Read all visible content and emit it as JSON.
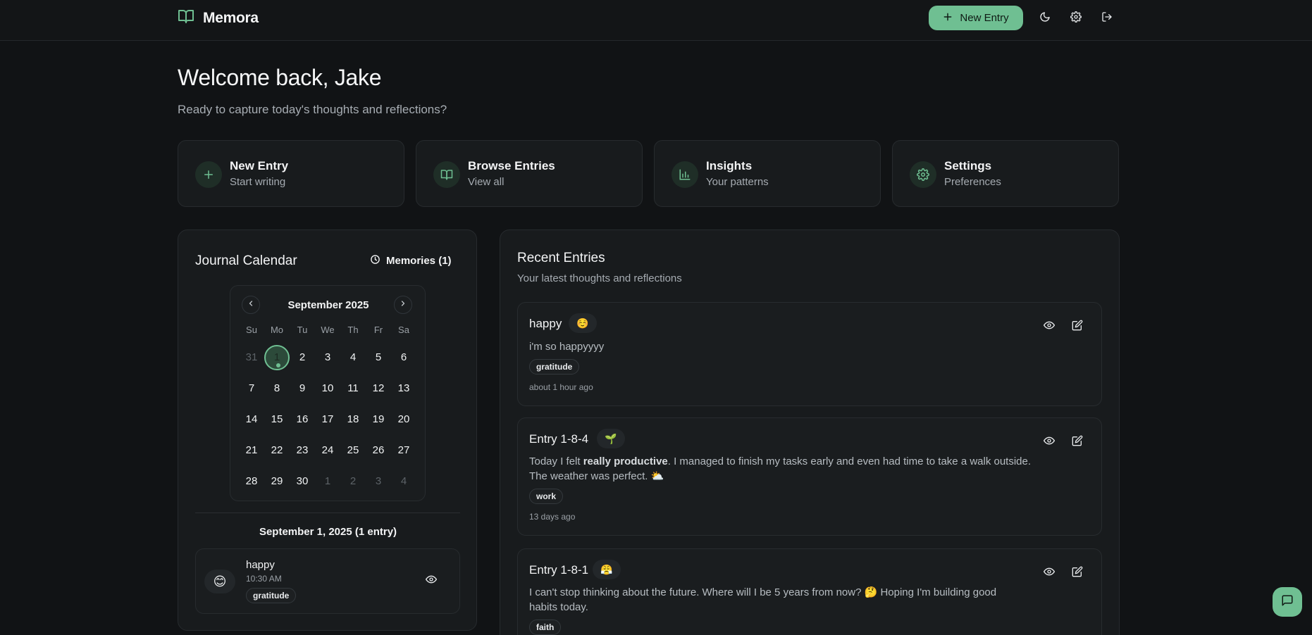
{
  "app": {
    "name": "Memora"
  },
  "header": {
    "new_entry_label": "New Entry"
  },
  "welcome": {
    "title": "Welcome back, Jake",
    "subtitle": "Ready to capture today's thoughts and reflections?"
  },
  "quick_actions": [
    {
      "title": "New Entry",
      "sub": "Start writing",
      "icon": "plus-icon"
    },
    {
      "title": "Browse Entries",
      "sub": "View all",
      "icon": "book-icon"
    },
    {
      "title": "Insights",
      "sub": "Your patterns",
      "icon": "chart-icon"
    },
    {
      "title": "Settings",
      "sub": "Preferences",
      "icon": "gear-icon"
    }
  ],
  "calendar": {
    "title": "Journal Calendar",
    "memories_label": "Memories (1)",
    "month": "September 2025",
    "weekdays": [
      "Su",
      "Mo",
      "Tu",
      "We",
      "Th",
      "Fr",
      "Sa"
    ],
    "days": [
      [
        "31",
        "1",
        "2",
        "3",
        "4",
        "5",
        "6"
      ],
      [
        "7",
        "8",
        "9",
        "10",
        "11",
        "12",
        "13"
      ],
      [
        "14",
        "15",
        "16",
        "17",
        "18",
        "19",
        "20"
      ],
      [
        "21",
        "22",
        "23",
        "24",
        "25",
        "26",
        "27"
      ],
      [
        "28",
        "29",
        "30",
        "1",
        "2",
        "3",
        "4"
      ]
    ],
    "selected_label": "September 1, 2025 (1 entry)",
    "day_entry": {
      "emoji": "😊",
      "title": "happy",
      "time": "10:30 AM",
      "tag": "gratitude"
    }
  },
  "recent": {
    "title": "Recent Entries",
    "subtitle": "Your latest thoughts and reflections",
    "entries": [
      {
        "title": "happy",
        "emoji": "☺️",
        "body": "i'm so happyyyy",
        "tag": "gratitude",
        "time": "about 1 hour ago"
      },
      {
        "title": "Entry 1-8-4",
        "emoji": "🌱",
        "body_pre": "Today I felt ",
        "body_bold": "really productive",
        "body_post": ". I managed to finish my tasks early and even had time to take a walk outside. The weather was perfect. ⛅",
        "tag": "work",
        "time": "13 days ago"
      },
      {
        "title": "Entry 1-8-1",
        "emoji": "😤",
        "body": "I can't stop thinking about the future. Where will I be 5 years from now? 🤔 Hoping I'm building good habits today.",
        "tag": "faith",
        "time": ""
      }
    ]
  },
  "colors": {
    "accent": "#6fbf92",
    "background": "#111315",
    "panel": "#181b1d"
  }
}
